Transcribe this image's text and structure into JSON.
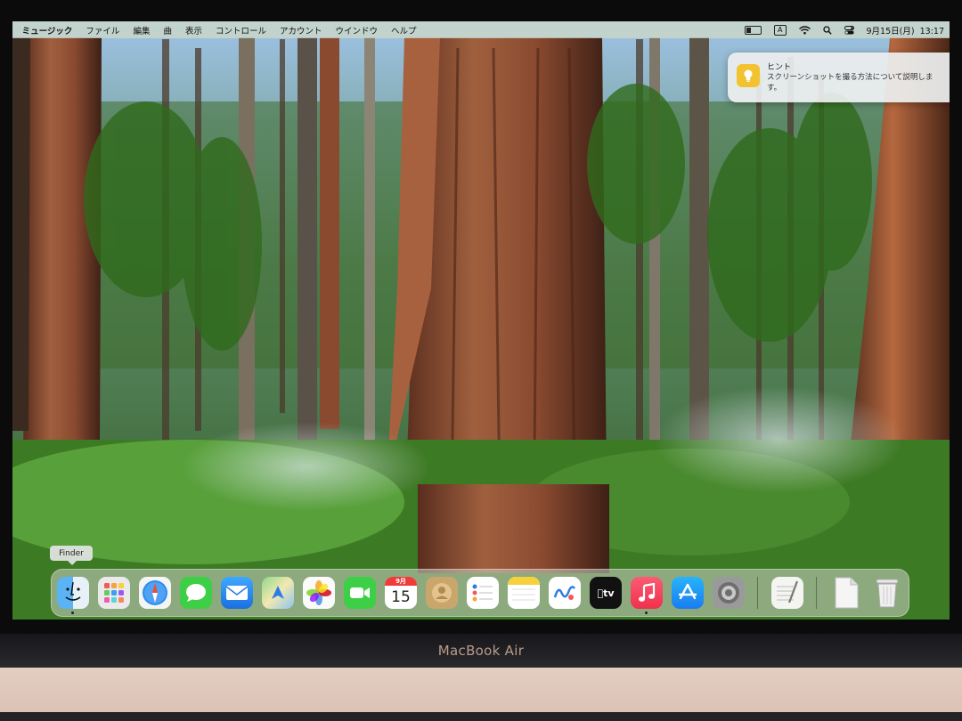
{
  "menubar": {
    "app_name": "ミュージック",
    "items": [
      "ファイル",
      "編集",
      "曲",
      "表示",
      "コントロール",
      "アカウント",
      "ウインドウ",
      "ヘルプ"
    ],
    "input_source": "A",
    "date": "9月15日(月)",
    "time": "13:17"
  },
  "notification": {
    "title": "ヒント",
    "body": "スクリーンショットを撮る方法について説明します。",
    "icon": "lightbulb-icon",
    "icon_color": "#f3c32f"
  },
  "dock": {
    "tooltip": "Finder",
    "calendar_month": "9月",
    "calendar_day": "15",
    "apps": [
      "finder",
      "launchpad",
      "safari",
      "messages",
      "mail",
      "maps",
      "photos",
      "facetime",
      "calendar",
      "contacts",
      "reminders",
      "notes",
      "freeform",
      "tv",
      "music",
      "app-store",
      "system-settings",
      "textedit",
      "document",
      "trash"
    ]
  },
  "laptop": {
    "brand": "MacBook Air"
  }
}
